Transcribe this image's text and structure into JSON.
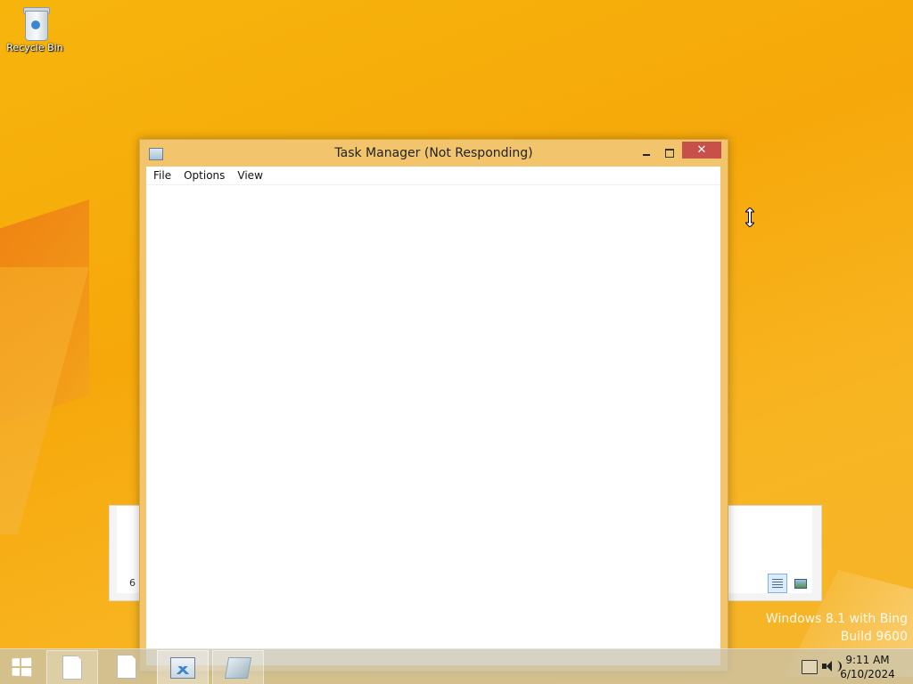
{
  "desktop": {
    "icons": [
      {
        "label": "Recycle Bin",
        "icon": "recycle-bin-icon"
      }
    ],
    "watermark": {
      "line1": "Windows 8.1 with Bing",
      "line2": "Build 9600"
    }
  },
  "background_window": {
    "status_text": "6 i"
  },
  "task_manager": {
    "title": "Task Manager (Not Responding)",
    "menu": [
      "File",
      "Options",
      "View"
    ],
    "close_glyph": "✕"
  },
  "taskbar": {
    "buttons": [
      {
        "name": "document-app",
        "icon": "document-icon"
      },
      {
        "name": "document-app-2",
        "icon": "document-icon"
      },
      {
        "name": "task-manager",
        "icon": "task-manager-icon"
      },
      {
        "name": "app-gem",
        "icon": "app-icon"
      }
    ],
    "clock": {
      "time": "9:11 AM",
      "date": "6/10/2024"
    }
  },
  "colors": {
    "desktop_bg": "#f7b50c",
    "window_frame": "#f2c56c",
    "close_button": "#c7504a"
  }
}
